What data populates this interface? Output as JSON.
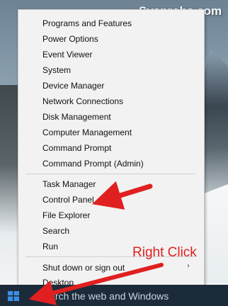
{
  "watermark": "Sysprobs.com",
  "menu": {
    "groups": [
      [
        "Programs and Features",
        "Power Options",
        "Event Viewer",
        "System",
        "Device Manager",
        "Network Connections",
        "Disk Management",
        "Computer Management",
        "Command Prompt",
        "Command Prompt (Admin)"
      ],
      [
        "Task Manager",
        "Control Panel",
        "File Explorer",
        "Search",
        "Run"
      ],
      [
        "Shut down or sign out",
        "Desktop"
      ]
    ],
    "submenu_arrow": "›"
  },
  "taskbar": {
    "search_text": "Search the web and Windows",
    "start_icon": "windows-logo-icon"
  },
  "annotation": {
    "text": "Right Click",
    "color": "#e02020"
  }
}
